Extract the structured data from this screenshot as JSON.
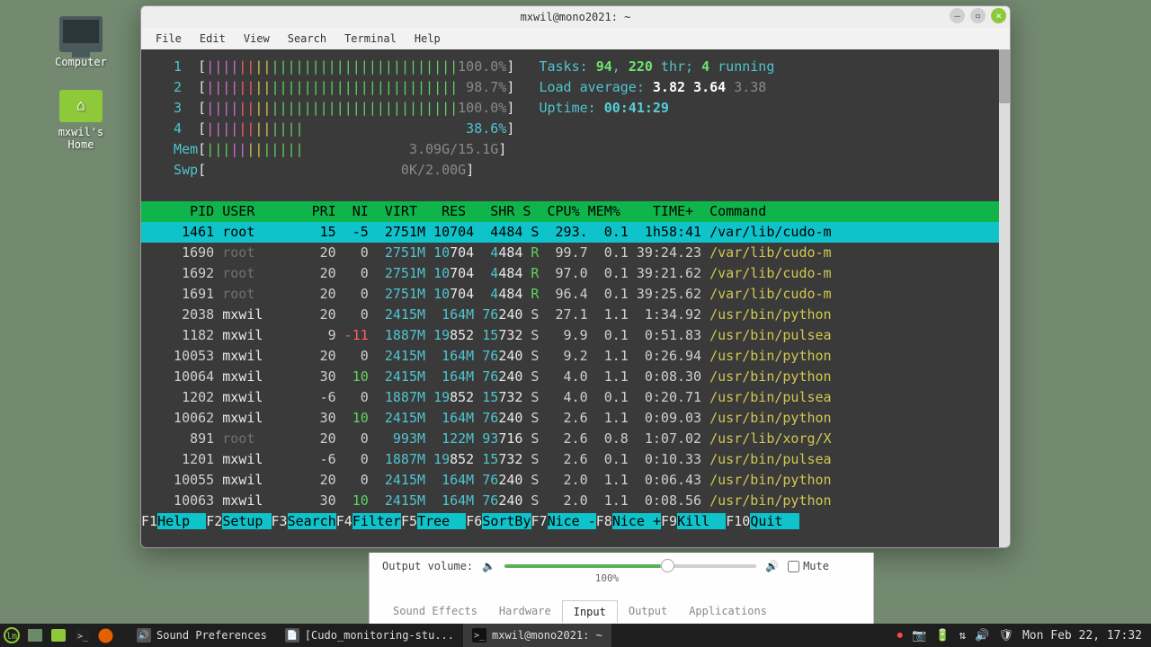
{
  "desktop": {
    "computer": "Computer",
    "home": "mxwil's Home"
  },
  "window": {
    "title": "mxwil@mono2021: ~",
    "menu": [
      "File",
      "Edit",
      "View",
      "Search",
      "Terminal",
      "Help"
    ]
  },
  "htop": {
    "cpus": [
      {
        "n": "1",
        "pct": "100.0%"
      },
      {
        "n": "2",
        "pct": "98.7%"
      },
      {
        "n": "3",
        "pct": "100.0%"
      },
      {
        "n": "4",
        "pct": "38.6%"
      }
    ],
    "mem": {
      "label": "Mem",
      "used": "3.09G/15.1G"
    },
    "swp": {
      "label": "Swp",
      "used": "0K/2.00G"
    },
    "tasks": {
      "label": "Tasks:",
      "procs": "94",
      "thr": "220",
      "txt1": " thr; ",
      "run": "4",
      "txt2": " running"
    },
    "load": {
      "label": "Load average:",
      "a": "3.82",
      "b": "3.64",
      "c": "3.38"
    },
    "uptime": {
      "label": "Uptime:",
      "val": "00:41:29"
    },
    "headers": "    PID USER       PRI  NI  VIRT   RES   SHR S  CPU% MEM%    TIME+  Command            ",
    "rows": [
      {
        "pid": "1461",
        "user": "root",
        "pri": "15",
        "ni": "-5",
        "virt": "2751M",
        "res": "10704",
        "shr": "4484",
        "s": "S",
        "cpu": "293.",
        "mem": "0.1",
        "time": "1h58:41",
        "cmd": "/var/lib/cudo-m",
        "sel": true,
        "dimu": false
      },
      {
        "pid": "1690",
        "user": "root",
        "pri": "20",
        "ni": "0",
        "virt": "2751M",
        "res": "10704",
        "shr": "4484",
        "s": "R",
        "cpu": "99.7",
        "mem": "0.1",
        "time": "39:24.23",
        "cmd": "/var/lib/cudo-m",
        "dimu": true
      },
      {
        "pid": "1692",
        "user": "root",
        "pri": "20",
        "ni": "0",
        "virt": "2751M",
        "res": "10704",
        "shr": "4484",
        "s": "R",
        "cpu": "97.0",
        "mem": "0.1",
        "time": "39:21.62",
        "cmd": "/var/lib/cudo-m",
        "dimu": true
      },
      {
        "pid": "1691",
        "user": "root",
        "pri": "20",
        "ni": "0",
        "virt": "2751M",
        "res": "10704",
        "shr": "4484",
        "s": "R",
        "cpu": "96.4",
        "mem": "0.1",
        "time": "39:25.62",
        "cmd": "/var/lib/cudo-m",
        "dimu": true
      },
      {
        "pid": "2038",
        "user": "mxwil",
        "pri": "20",
        "ni": "0",
        "virt": "2415M",
        "res": "164M",
        "shr": "76240",
        "s": "S",
        "cpu": "27.1",
        "mem": "1.1",
        "time": "1:34.92",
        "cmd": "/usr/bin/python"
      },
      {
        "pid": "1182",
        "user": "mxwil",
        "pri": "9",
        "ni": "-11",
        "virt": "1887M",
        "res": "19852",
        "shr": "15732",
        "s": "S",
        "cpu": "9.9",
        "mem": "0.1",
        "time": "0:51.83",
        "cmd": "/usr/bin/pulsea",
        "redni": true
      },
      {
        "pid": "10053",
        "user": "mxwil",
        "pri": "20",
        "ni": "0",
        "virt": "2415M",
        "res": "164M",
        "shr": "76240",
        "s": "S",
        "cpu": "9.2",
        "mem": "1.1",
        "time": "0:26.94",
        "cmd": "/usr/bin/python"
      },
      {
        "pid": "10064",
        "user": "mxwil",
        "pri": "30",
        "ni": "10",
        "virt": "2415M",
        "res": "164M",
        "shr": "76240",
        "s": "S",
        "cpu": "4.0",
        "mem": "1.1",
        "time": "0:08.30",
        "cmd": "/usr/bin/python",
        "greenni": true
      },
      {
        "pid": "1202",
        "user": "mxwil",
        "pri": "-6",
        "ni": "0",
        "virt": "1887M",
        "res": "19852",
        "shr": "15732",
        "s": "S",
        "cpu": "4.0",
        "mem": "0.1",
        "time": "0:20.71",
        "cmd": "/usr/bin/pulsea"
      },
      {
        "pid": "10062",
        "user": "mxwil",
        "pri": "30",
        "ni": "10",
        "virt": "2415M",
        "res": "164M",
        "shr": "76240",
        "s": "S",
        "cpu": "2.6",
        "mem": "1.1",
        "time": "0:09.03",
        "cmd": "/usr/bin/python",
        "greenni": true
      },
      {
        "pid": "891",
        "user": "root",
        "pri": "20",
        "ni": "0",
        "virt": "993M",
        "res": "122M",
        "shr": "93716",
        "s": "S",
        "cpu": "2.6",
        "mem": "0.8",
        "time": "1:07.02",
        "cmd": "/usr/lib/xorg/X",
        "dimu": true
      },
      {
        "pid": "1201",
        "user": "mxwil",
        "pri": "-6",
        "ni": "0",
        "virt": "1887M",
        "res": "19852",
        "shr": "15732",
        "s": "S",
        "cpu": "2.6",
        "mem": "0.1",
        "time": "0:10.33",
        "cmd": "/usr/bin/pulsea"
      },
      {
        "pid": "10055",
        "user": "mxwil",
        "pri": "20",
        "ni": "0",
        "virt": "2415M",
        "res": "164M",
        "shr": "76240",
        "s": "S",
        "cpu": "2.0",
        "mem": "1.1",
        "time": "0:06.43",
        "cmd": "/usr/bin/python"
      },
      {
        "pid": "10063",
        "user": "mxwil",
        "pri": "30",
        "ni": "10",
        "virt": "2415M",
        "res": "164M",
        "shr": "76240",
        "s": "S",
        "cpu": "2.0",
        "mem": "1.1",
        "time": "0:08.56",
        "cmd": "/usr/bin/python",
        "greenni": true
      }
    ],
    "fkeys": [
      {
        "k": "F1",
        "l": "Help  "
      },
      {
        "k": "F2",
        "l": "Setup "
      },
      {
        "k": "F3",
        "l": "Search"
      },
      {
        "k": "F4",
        "l": "Filter"
      },
      {
        "k": "F5",
        "l": "Tree  "
      },
      {
        "k": "F6",
        "l": "SortBy"
      },
      {
        "k": "F7",
        "l": "Nice -"
      },
      {
        "k": "F8",
        "l": "Nice +"
      },
      {
        "k": "F9",
        "l": "Kill  "
      },
      {
        "k": "F10",
        "l": "Quit  "
      }
    ]
  },
  "sound": {
    "label": "Output volume:",
    "pct": "100%",
    "mute": "Mute",
    "tabs": [
      "Sound Effects",
      "Hardware",
      "Input",
      "Output",
      "Applications"
    ],
    "active": 2
  },
  "panel": {
    "tasks": [
      {
        "label": "Sound Preferences",
        "active": false
      },
      {
        "label": "[Cudo_monitoring-stu...",
        "active": false
      },
      {
        "label": "mxwil@mono2021: ~",
        "active": true
      }
    ],
    "clock": "Mon Feb 22, 17:32"
  }
}
